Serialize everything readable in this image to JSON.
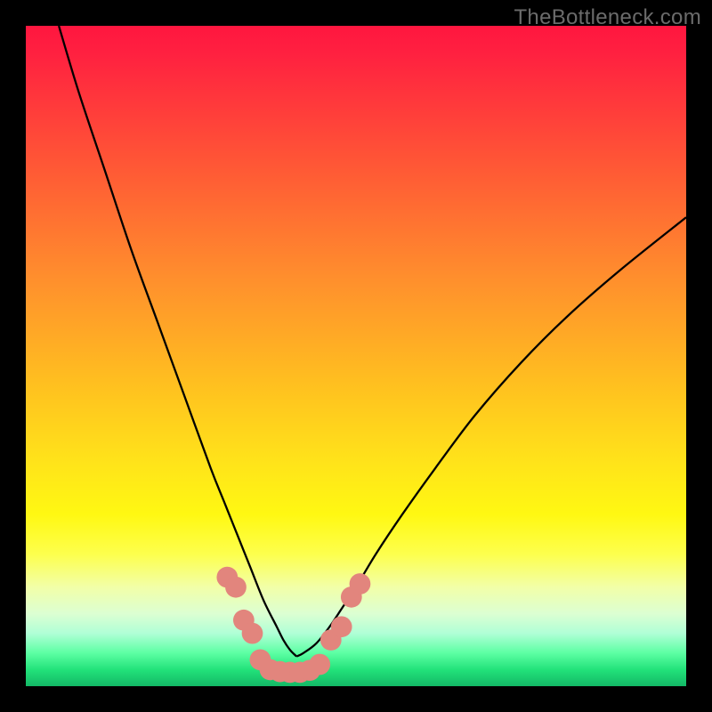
{
  "watermark": "TheBottleneck.com",
  "chart_data": {
    "type": "line",
    "title": "",
    "xlabel": "",
    "ylabel": "",
    "xlim": [
      0,
      100
    ],
    "ylim": [
      0,
      100
    ],
    "series": [
      {
        "name": "left-curve",
        "x": [
          5,
          8,
          12,
          16,
          20,
          24,
          28,
          30,
          32,
          34,
          36,
          38,
          39,
          40,
          41
        ],
        "y": [
          100,
          90,
          78,
          66,
          55,
          44,
          33,
          28,
          23,
          18,
          13,
          9,
          7,
          5.5,
          4.5
        ]
      },
      {
        "name": "right-curve",
        "x": [
          41,
          42,
          44,
          46,
          48,
          50,
          53,
          57,
          62,
          68,
          75,
          82,
          90,
          100
        ],
        "y": [
          4.5,
          5,
          6.5,
          9,
          12,
          15,
          20,
          26,
          33,
          41,
          49,
          56,
          63,
          71
        ]
      }
    ],
    "markers": [
      {
        "x": 30.5,
        "y": 16.5,
        "r": 1.6
      },
      {
        "x": 31.8,
        "y": 15.0,
        "r": 1.6
      },
      {
        "x": 33.0,
        "y": 10.0,
        "r": 1.6
      },
      {
        "x": 34.3,
        "y": 8.0,
        "r": 1.6
      },
      {
        "x": 35.5,
        "y": 4.0,
        "r": 1.6
      },
      {
        "x": 37.0,
        "y": 2.5,
        "r": 1.6
      },
      {
        "x": 38.5,
        "y": 2.2,
        "r": 1.6
      },
      {
        "x": 40.0,
        "y": 2.1,
        "r": 1.6
      },
      {
        "x": 41.5,
        "y": 2.1,
        "r": 1.6
      },
      {
        "x": 43.0,
        "y": 2.4,
        "r": 1.6
      },
      {
        "x": 44.5,
        "y": 3.3,
        "r": 1.6
      },
      {
        "x": 46.2,
        "y": 7.0,
        "r": 1.6
      },
      {
        "x": 47.8,
        "y": 9.0,
        "r": 1.6
      },
      {
        "x": 49.3,
        "y": 13.5,
        "r": 1.6
      },
      {
        "x": 50.6,
        "y": 15.5,
        "r": 1.6
      }
    ]
  }
}
